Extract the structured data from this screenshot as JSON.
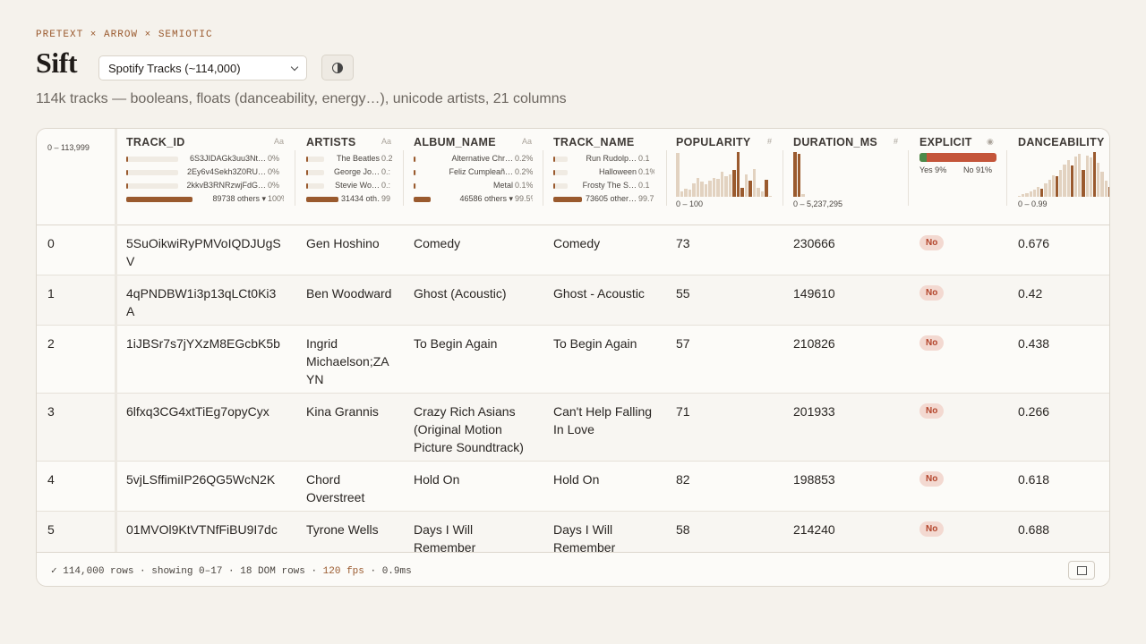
{
  "brand": "PRETEXT × ARROW × SEMIOTIC",
  "title": "Sift",
  "dataset_select": {
    "value": "Spotify Tracks (~114,000)"
  },
  "theme_toggle_icon": "half-circle-icon",
  "subtitle": "114k tracks — booleans, floats (danceability, energy…), unicode artists, 21 columns",
  "colors": {
    "accent": "#9a5a2e",
    "hist_light": "#e2d2c0",
    "bool_yes": "#4d8a4a",
    "bool_no": "#c4553a",
    "badge_bg": "#f3d9d1",
    "badge_text": "#b3442a"
  },
  "index_range": "0 – 113,999",
  "columns": {
    "track_id": {
      "name": "TRACK_ID",
      "type": "Aa",
      "top": [
        {
          "label": "6S3JIDAGk3uu3Nt…",
          "pct": "0%",
          "frac": 0.0
        },
        {
          "label": "2Ey6v4Sekh3Z0RU…",
          "pct": "0%",
          "frac": 0.0
        },
        {
          "label": "2kkvB3RNRzwjFdG…",
          "pct": "0%",
          "frac": 0.0
        }
      ],
      "others": {
        "label": "89738 others ▾",
        "pct": "100%",
        "frac": 1.0
      }
    },
    "artists": {
      "name": "ARTISTS",
      "type": "Aa",
      "top": [
        {
          "label": "The Beatles",
          "pct": "0.2",
          "frac": 0.002
        },
        {
          "label": "George Jo…",
          "pct": "0.:",
          "frac": 0.002
        },
        {
          "label": "Stevie Wo…",
          "pct": "0.:",
          "frac": 0.002
        }
      ],
      "others": {
        "label": "31434 oth…",
        "pct": "99",
        "frac": 0.99
      }
    },
    "album_name": {
      "name": "ALBUM_NAME",
      "type": "Aa",
      "top": [
        {
          "label": "Alternative Chr…",
          "pct": "0.2%",
          "frac": 0.002
        },
        {
          "label": "Feliz Cumpleañ…",
          "pct": "0.2%",
          "frac": 0.002
        },
        {
          "label": "Metal",
          "pct": "0.1%",
          "frac": 0.001
        }
      ],
      "others": {
        "label": "46586 others ▾",
        "pct": "99.5%",
        "frac": 0.995
      }
    },
    "track_name": {
      "name": "TRACK_NAME",
      "type": "",
      "top": [
        {
          "label": "Run Rudolp…",
          "pct": "0.1",
          "frac": 0.001
        },
        {
          "label": "Halloween",
          "pct": "0.1%",
          "frac": 0.001
        },
        {
          "label": "Frosty The S…",
          "pct": "0.1",
          "frac": 0.001
        }
      ],
      "others": {
        "label": "73605 other…",
        "pct": "99.7",
        "frac": 0.997
      }
    },
    "popularity": {
      "name": "POPULARITY",
      "type": "#",
      "range": "0 – 100",
      "bins": [
        {
          "v": 0.98,
          "sel": false
        },
        {
          "v": 0.12,
          "sel": false
        },
        {
          "v": 0.18,
          "sel": false
        },
        {
          "v": 0.16,
          "sel": false
        },
        {
          "v": 0.3,
          "sel": false
        },
        {
          "v": 0.42,
          "sel": false
        },
        {
          "v": 0.33,
          "sel": false
        },
        {
          "v": 0.28,
          "sel": false
        },
        {
          "v": 0.36,
          "sel": false
        },
        {
          "v": 0.42,
          "sel": false
        },
        {
          "v": 0.4,
          "sel": false
        },
        {
          "v": 0.55,
          "sel": false
        },
        {
          "v": 0.45,
          "sel": false
        },
        {
          "v": 0.5,
          "sel": false
        },
        {
          "v": 0.6,
          "sel": true
        },
        {
          "v": 1.0,
          "sel": true
        },
        {
          "v": 0.2,
          "sel": true
        },
        {
          "v": 0.5,
          "sel": false
        },
        {
          "v": 0.35,
          "sel": true
        },
        {
          "v": 0.62,
          "sel": false
        },
        {
          "v": 0.2,
          "sel": false
        },
        {
          "v": 0.12,
          "sel": false
        },
        {
          "v": 0.38,
          "sel": true
        },
        {
          "v": 0.02,
          "sel": false
        }
      ]
    },
    "duration_ms": {
      "name": "DURATION_MS",
      "type": "#",
      "range": "0 – 5,237,295",
      "bins": [
        {
          "v": 1.0,
          "sel": true
        },
        {
          "v": 0.95,
          "sel": true
        },
        {
          "v": 0.06,
          "sel": false
        }
      ]
    },
    "explicit": {
      "name": "EXPLICIT",
      "type": "◉",
      "yes_label": "Yes 9%",
      "no_label": "No 91%",
      "yes_frac": 0.09
    },
    "danceability": {
      "name": "DANCEABILITY",
      "range": "0 – 0.99",
      "bins": [
        {
          "v": 0.02,
          "sel": false
        },
        {
          "v": 0.05,
          "sel": false
        },
        {
          "v": 0.08,
          "sel": false
        },
        {
          "v": 0.12,
          "sel": false
        },
        {
          "v": 0.16,
          "sel": false
        },
        {
          "v": 0.22,
          "sel": false
        },
        {
          "v": 0.18,
          "sel": true
        },
        {
          "v": 0.3,
          "sel": false
        },
        {
          "v": 0.38,
          "sel": false
        },
        {
          "v": 0.48,
          "sel": false
        },
        {
          "v": 0.45,
          "sel": true
        },
        {
          "v": 0.6,
          "sel": false
        },
        {
          "v": 0.72,
          "sel": false
        },
        {
          "v": 0.82,
          "sel": false
        },
        {
          "v": 0.7,
          "sel": true
        },
        {
          "v": 0.9,
          "sel": false
        },
        {
          "v": 0.95,
          "sel": false
        },
        {
          "v": 0.6,
          "sel": true
        },
        {
          "v": 0.92,
          "sel": false
        },
        {
          "v": 0.88,
          "sel": false
        },
        {
          "v": 1.0,
          "sel": true
        },
        {
          "v": 0.75,
          "sel": false
        },
        {
          "v": 0.55,
          "sel": false
        },
        {
          "v": 0.35,
          "sel": false
        },
        {
          "v": 0.22,
          "sel": true
        }
      ]
    }
  },
  "rows": [
    {
      "index": "0",
      "track_id": "5SuOikwiRyPMVoIQDJUgSV",
      "artists": "Gen Hoshino",
      "album_name": "Comedy",
      "track_name": "Comedy",
      "popularity": "73",
      "duration_ms": "230666",
      "explicit": "No",
      "danceability": "0.676"
    },
    {
      "index": "1",
      "track_id": "4qPNDBW1i3p13qLCt0Ki3A",
      "artists": "Ben Woodward",
      "album_name": "Ghost (Acoustic)",
      "track_name": "Ghost - Acoustic",
      "popularity": "55",
      "duration_ms": "149610",
      "explicit": "No",
      "danceability": "0.42"
    },
    {
      "index": "2",
      "track_id": "1iJBSr7s7jYXzM8EGcbK5b",
      "artists": "Ingrid Michaelson;ZAYN",
      "album_name": "To Begin Again",
      "track_name": "To Begin Again",
      "popularity": "57",
      "duration_ms": "210826",
      "explicit": "No",
      "danceability": "0.438"
    },
    {
      "index": "3",
      "track_id": "6lfxq3CG4xtTiEg7opyCyx",
      "artists": "Kina Grannis",
      "album_name": "Crazy Rich Asians (Original Motion Picture Soundtrack)",
      "track_name": "Can't Help Falling In Love",
      "popularity": "71",
      "duration_ms": "201933",
      "explicit": "No",
      "danceability": "0.266"
    },
    {
      "index": "4",
      "track_id": "5vjLSffimiIP26QG5WcN2K",
      "artists": "Chord Overstreet",
      "album_name": "Hold On",
      "track_name": "Hold On",
      "popularity": "82",
      "duration_ms": "198853",
      "explicit": "No",
      "danceability": "0.618"
    },
    {
      "index": "5",
      "track_id": "01MVOl9KtVTNfFiBU9I7dc",
      "artists": "Tyrone Wells",
      "album_name": "Days I Will Remember",
      "track_name": "Days I Will Remember",
      "popularity": "58",
      "duration_ms": "214240",
      "explicit": "No",
      "danceability": "0.688"
    }
  ],
  "footer": {
    "status_prefix": "✓ 114,000 rows · showing 0–17 · 18 DOM rows · ",
    "fps": "120 fps",
    "timing": " · 0.9ms",
    "fullscreen_icon": "fullscreen-icon"
  }
}
